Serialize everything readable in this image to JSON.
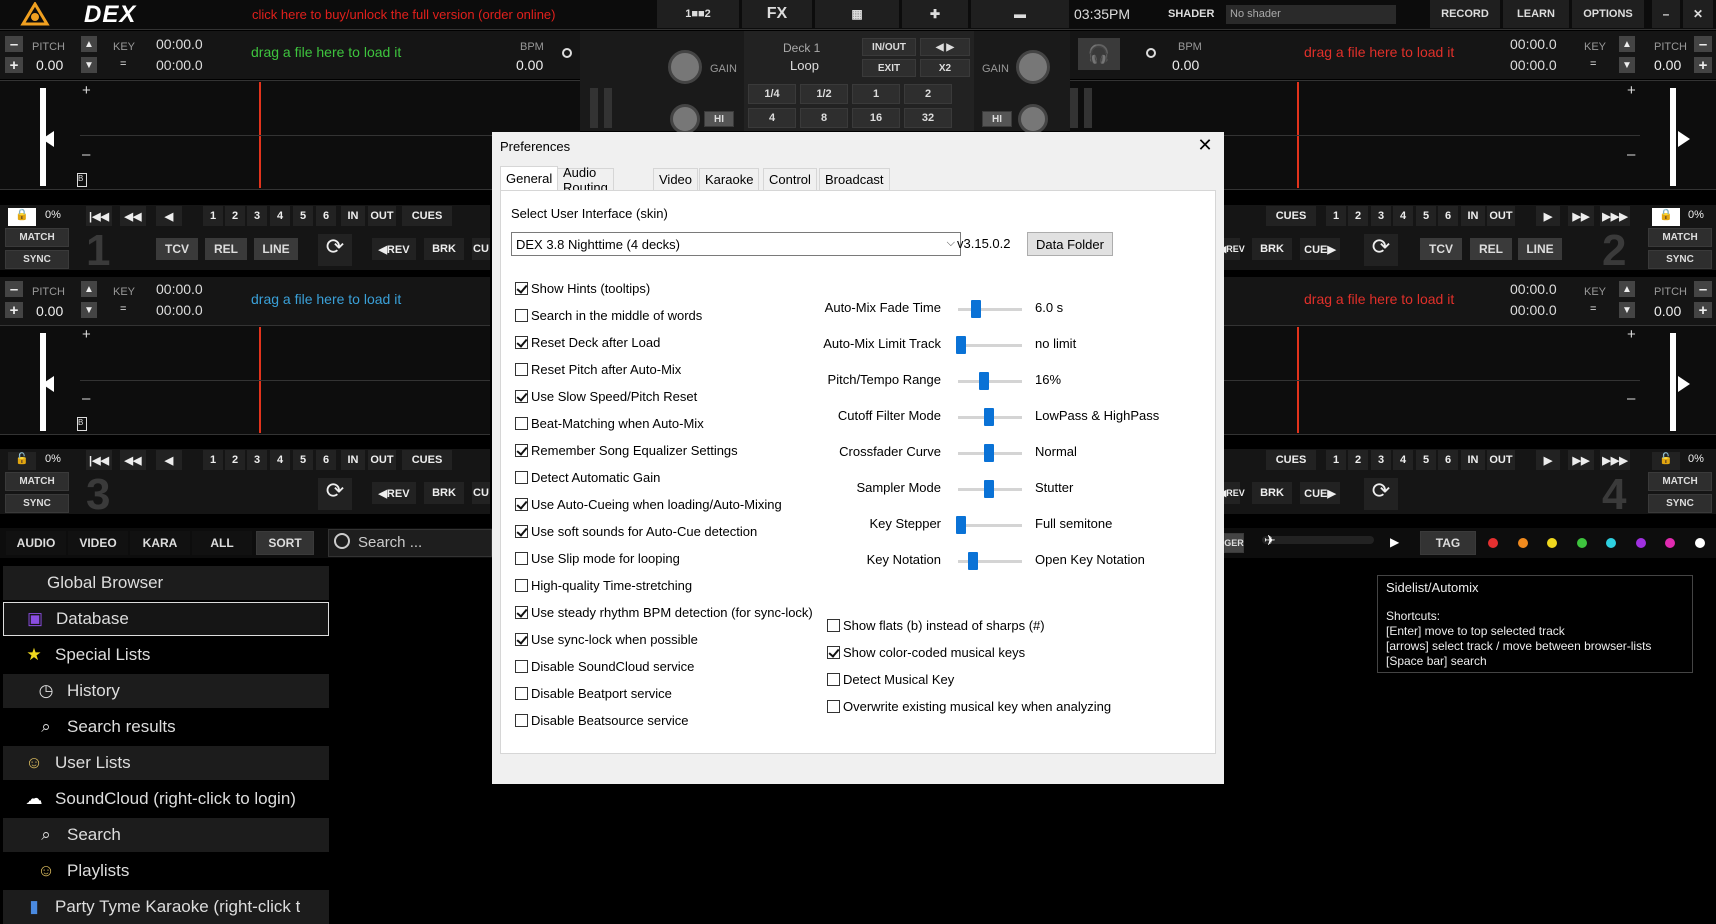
{
  "app": {
    "logo": "DEX",
    "promo": "click here to buy/unlock the full version (order online)"
  },
  "topbar": {
    "layout_label": "1■■2",
    "fx": "FX",
    "time": "03:35PM",
    "shader_label": "SHADER",
    "shader_value": "No shader",
    "record": "RECORD",
    "learn": "LEARN",
    "options": "OPTIONS",
    "minimize": "–",
    "close": "✕"
  },
  "deck_common": {
    "pitch": "PITCH",
    "pitch_val": "0.00",
    "key": "KEY",
    "key_val": "=",
    "time1": "00:00.0",
    "time2": "00:00.0",
    "bpm": "BPM",
    "bpm_val": "0.00",
    "hint": "drag a file here to load it",
    "pct": "0%",
    "match": "MATCH",
    "sync": "SYNC",
    "cues": "CUES",
    "in": "IN",
    "out": "OUT",
    "tcv": "TCV",
    "rel": "REL",
    "line": "LINE",
    "rev": "◀REV",
    "brk": "BRK",
    "cue": "CUE▶",
    "cu": "CU"
  },
  "center": {
    "gain": "GAIN",
    "hi": "HI",
    "deck": "Deck 1",
    "loop": "Loop",
    "inout": "IN/OUT",
    "exit": "EXIT",
    "x2": "X2",
    "loop_vals": [
      "1/4",
      "1/2",
      "1",
      "2",
      "4",
      "8",
      "16",
      "32"
    ]
  },
  "deck_numbers": [
    "1",
    "2",
    "3",
    "4"
  ],
  "hotcues": [
    "1",
    "2",
    "3",
    "4",
    "5",
    "6"
  ],
  "filters": {
    "audio": "AUDIO",
    "video": "VIDEO",
    "kara": "KARA",
    "all": "ALL",
    "sort": "SORT",
    "search_placeholder": "Search ..."
  },
  "right_toolbar": {
    "tag": "TAG",
    "ger": "GER"
  },
  "browser": {
    "items": [
      {
        "label": "Global Browser",
        "icon": "none",
        "indent": 0
      },
      {
        "label": "Database",
        "icon": "database-icon",
        "indent": 1
      },
      {
        "label": "Special Lists",
        "icon": "star-icon",
        "indent": 1
      },
      {
        "label": "History",
        "icon": "clock-icon",
        "indent": 2
      },
      {
        "label": "Search results",
        "icon": "magnifier-icon",
        "indent": 2
      },
      {
        "label": "User Lists",
        "icon": "user-icon",
        "indent": 1
      },
      {
        "label": "SoundCloud (right-click to login)",
        "icon": "cloud-icon",
        "indent": 1
      },
      {
        "label": "Search",
        "icon": "magnifier-icon",
        "indent": 2
      },
      {
        "label": "Playlists",
        "icon": "user-icon",
        "indent": 2
      },
      {
        "label": "Party Tyme Karaoke (right-click t",
        "icon": "karaoke-icon",
        "indent": 1
      }
    ]
  },
  "sidelist": {
    "title": "Sidelist/Automix",
    "shortcuts": "Shortcuts:",
    "line1": "[Enter] move to top selected track",
    "line2": "[arrows] select track / move between browser-lists",
    "line3": "[Space bar] search"
  },
  "colors": {
    "dots": [
      "#e53030",
      "#f08a1e",
      "#f0d81e",
      "#3ec43e",
      "#2ed0e0",
      "#a030e0",
      "#e02bb0",
      "#ffffff"
    ],
    "accent": "#0a72d6"
  },
  "prefs": {
    "title": "Preferences",
    "tabs": [
      "General",
      "Audio Routing",
      "Video",
      "Karaoke",
      "Control",
      "Broadcast"
    ],
    "skin_label": "Select User Interface (skin)",
    "skin_value": "DEX 3.8 Nighttime (4 decks)",
    "version": "v3.15.0.2",
    "data_folder": "Data Folder",
    "checks": [
      {
        "label": "Show Hints (tooltips)",
        "on": true
      },
      {
        "label": "Search in the middle of words",
        "on": false
      },
      {
        "label": "Reset Deck after Load",
        "on": true
      },
      {
        "label": "Reset Pitch after Auto-Mix",
        "on": false
      },
      {
        "label": "Use Slow Speed/Pitch Reset",
        "on": true
      },
      {
        "label": "Beat-Matching when Auto-Mix",
        "on": false
      },
      {
        "label": "Remember Song Equalizer Settings",
        "on": true
      },
      {
        "label": "Detect Automatic Gain",
        "on": false
      },
      {
        "label": "Use Auto-Cueing when loading/Auto-Mixing",
        "on": true
      },
      {
        "label": "Use soft sounds for Auto-Cue detection",
        "on": true
      },
      {
        "label": "Use Slip mode for looping",
        "on": false
      },
      {
        "label": "High-quality Time-stretching",
        "on": false
      },
      {
        "label": "Use steady rhythm BPM detection (for sync-lock)",
        "on": true
      },
      {
        "label": "Use sync-lock when possible",
        "on": true
      },
      {
        "label": "Disable SoundCloud service",
        "on": false
      },
      {
        "label": "Disable Beatport service",
        "on": false
      },
      {
        "label": "Disable Beatsource service",
        "on": false
      }
    ],
    "sliders": [
      {
        "label": "Auto-Mix Fade Time",
        "value": "6.0 s",
        "pos": 0.28
      },
      {
        "label": "Auto-Mix Limit Track",
        "value": "no limit",
        "pos": 0.05
      },
      {
        "label": "Pitch/Tempo Range",
        "value": "16%",
        "pos": 0.4
      },
      {
        "label": "Cutoff Filter Mode",
        "value": "LowPass & HighPass",
        "pos": 0.48
      },
      {
        "label": "Crossfader Curve",
        "value": "Normal",
        "pos": 0.48
      },
      {
        "label": "Sampler Mode",
        "value": "Stutter",
        "pos": 0.48
      },
      {
        "label": "Key Stepper",
        "value": "Full semitone",
        "pos": 0.05
      },
      {
        "label": "Key Notation",
        "value": "Open Key Notation",
        "pos": 0.24
      }
    ],
    "key_checks": [
      {
        "label": "Show flats (b) instead of sharps (#)",
        "on": false
      },
      {
        "label": "Show color-coded musical keys",
        "on": true
      },
      {
        "label": "Detect Musical Key",
        "on": false
      },
      {
        "label": "Overwrite existing musical key when analyzing",
        "on": false
      }
    ]
  }
}
